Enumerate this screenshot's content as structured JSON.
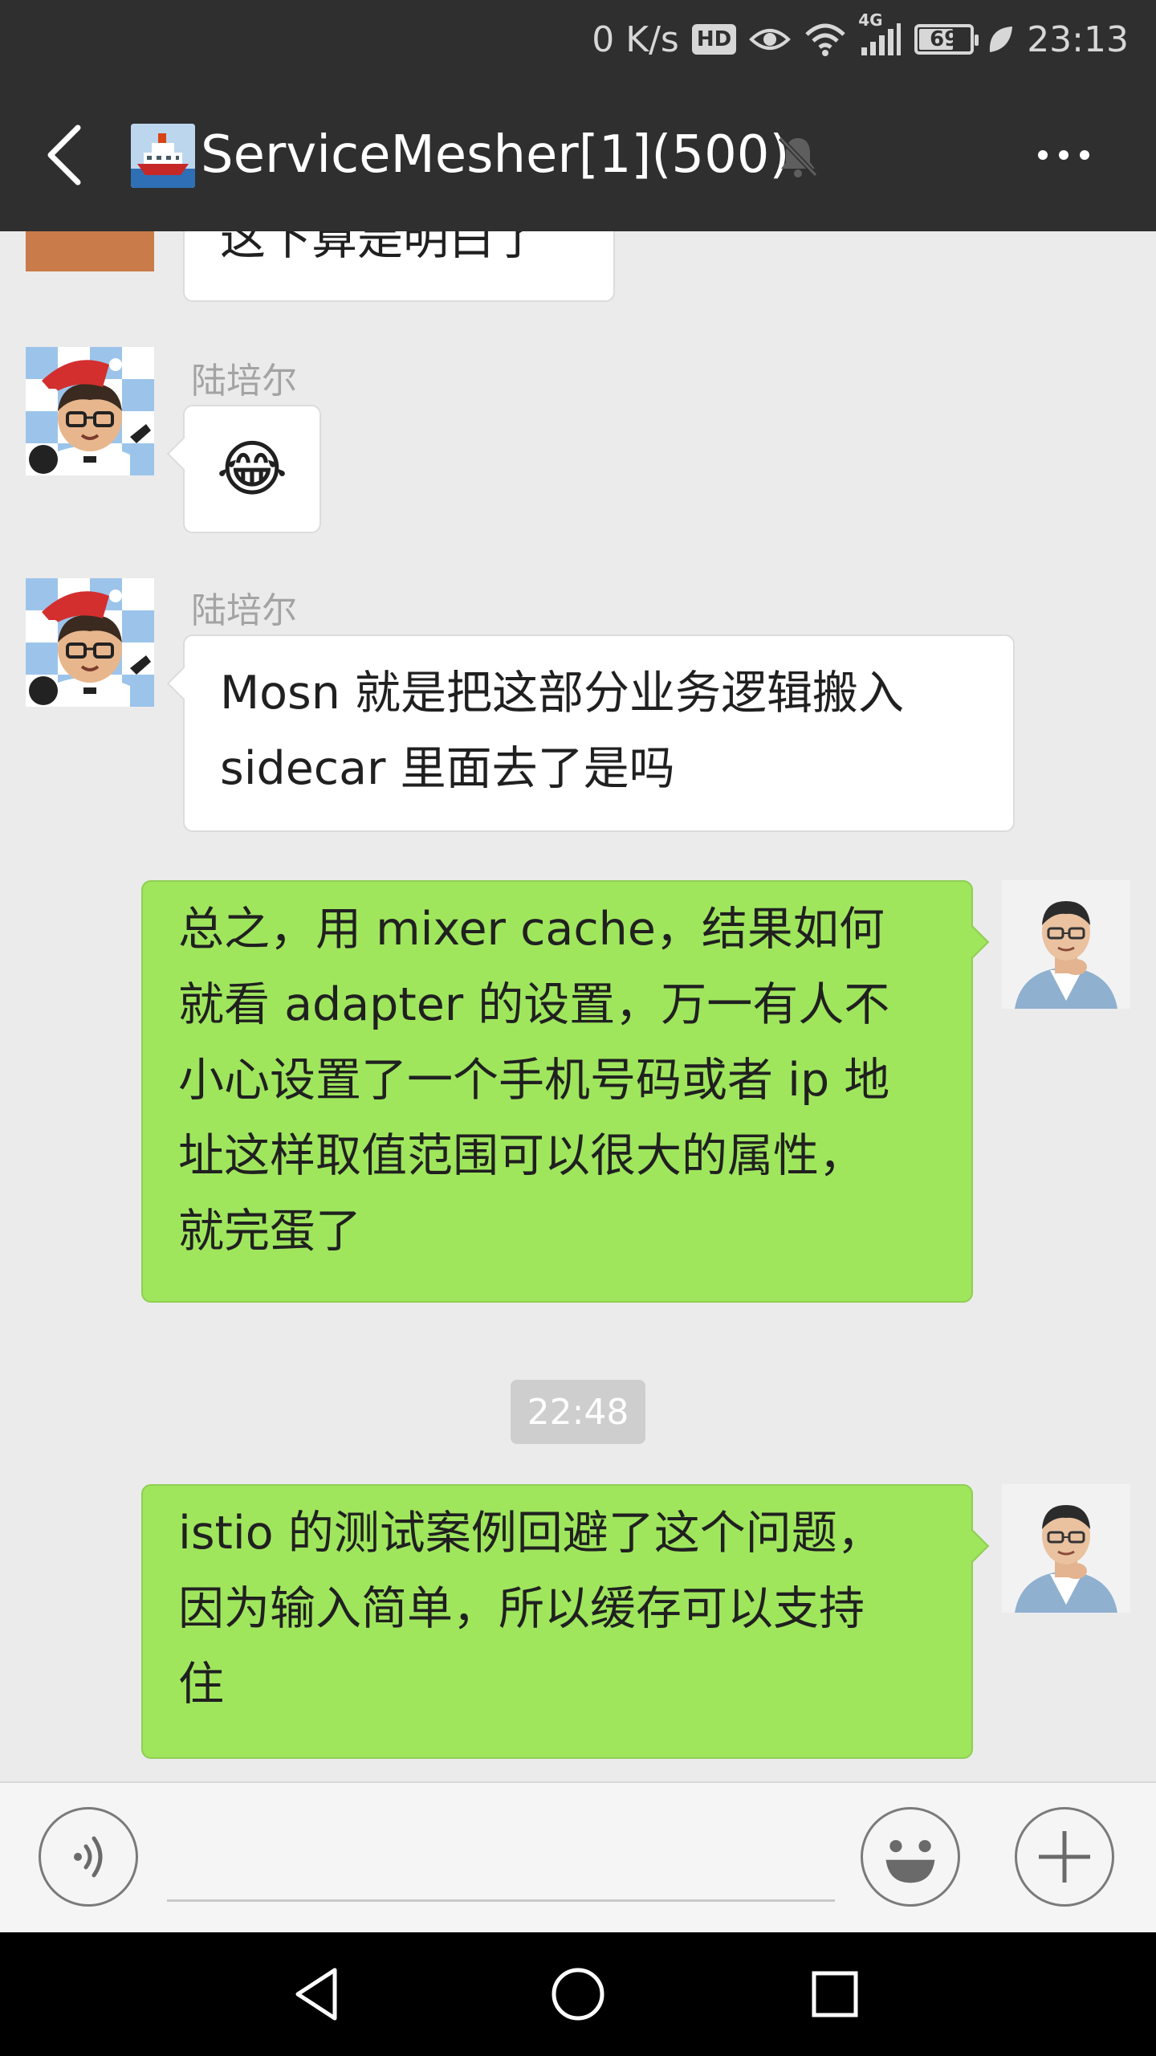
{
  "status_bar": {
    "net_speed": "0 K/s",
    "hd": "HD",
    "signal_type": "4G",
    "battery": "69",
    "battery_level": 0.69,
    "time": "23:13"
  },
  "header": {
    "title": "ServiceMesher[1](500)",
    "muted": true
  },
  "messages": [
    {
      "side": "left",
      "sender": "",
      "text": "这下算是明白了",
      "partial": true
    },
    {
      "side": "left",
      "sender": "陆培尔",
      "text": "😂"
    },
    {
      "side": "left",
      "sender": "陆培尔",
      "lines": [
        "Mosn 就是把这部分业务逻辑搬入",
        "sidecar 里面去了是吗"
      ]
    },
    {
      "side": "right",
      "lines": [
        "总之，用 mixer cache，结果如何",
        "就看 adapter 的设置，万一有人不",
        "小心设置了一个手机号码或者 ip 地",
        "址这样取值范围可以很大的属性，",
        "就完蛋了"
      ]
    },
    {
      "side": "right",
      "lines": [
        "istio 的测试案例回避了这个问题，",
        "因为输入简单，所以缓存可以支持",
        "住"
      ]
    }
  ],
  "timestamp": "22:48",
  "input": {
    "value": "",
    "placeholder": ""
  },
  "colors": {
    "header_bg": "#2f2f2f",
    "chat_bg": "#ebebeb",
    "sent_bubble": "#9fe65d",
    "received_bubble": "#ffffff"
  }
}
